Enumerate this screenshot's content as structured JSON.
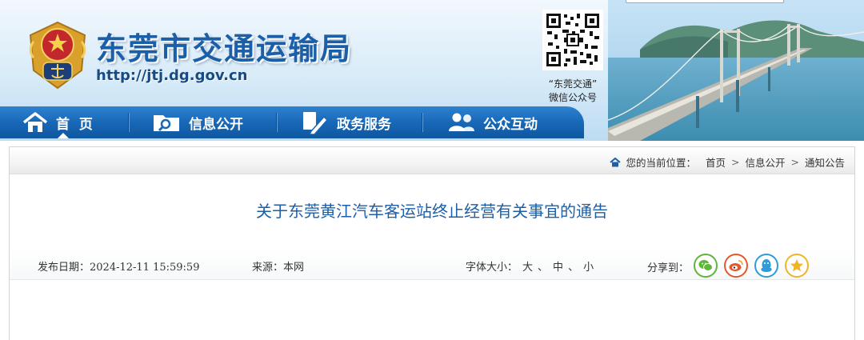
{
  "site": {
    "title": "东莞市交通运输局",
    "url": "http://jtj.dg.gov.cn",
    "qr_caption_line1": "“东莞交通”",
    "qr_caption_line2": "微信公众号"
  },
  "nav": {
    "items": [
      {
        "label": "首  页",
        "icon": "home-icon"
      },
      {
        "label": "信息公开",
        "icon": "search-icon"
      },
      {
        "label": "政务服务",
        "icon": "pen-icon"
      },
      {
        "label": "公众互动",
        "icon": "people-icon"
      }
    ]
  },
  "breadcrumb": {
    "prefix": "您的当前位置：",
    "items": [
      "首页",
      "信息公开",
      "通知公告"
    ],
    "separator": ">"
  },
  "article": {
    "title": "关于东莞黄江汽车客运站终止经营有关事宜的通告",
    "publish_date": "发布日期：2024-12-11 15:59:59",
    "source": "来源：本网",
    "font_size_label": "字体大小：",
    "font_sizes": [
      "大",
      "中",
      "小"
    ],
    "font_size_separator": "、",
    "share_label": "分享到："
  },
  "share": [
    {
      "name": "wechat-share-icon",
      "color": "#5fb63b"
    },
    {
      "name": "weibo-share-icon",
      "color": "#e5572c"
    },
    {
      "name": "qq-share-icon",
      "color": "#2f9bd8"
    },
    {
      "name": "qzone-share-icon",
      "color": "#f0b428"
    }
  ],
  "colors": {
    "brand_blue": "#1b5fa8",
    "nav_blue": "#1868b7",
    "article_title": "#1d5ea8"
  }
}
